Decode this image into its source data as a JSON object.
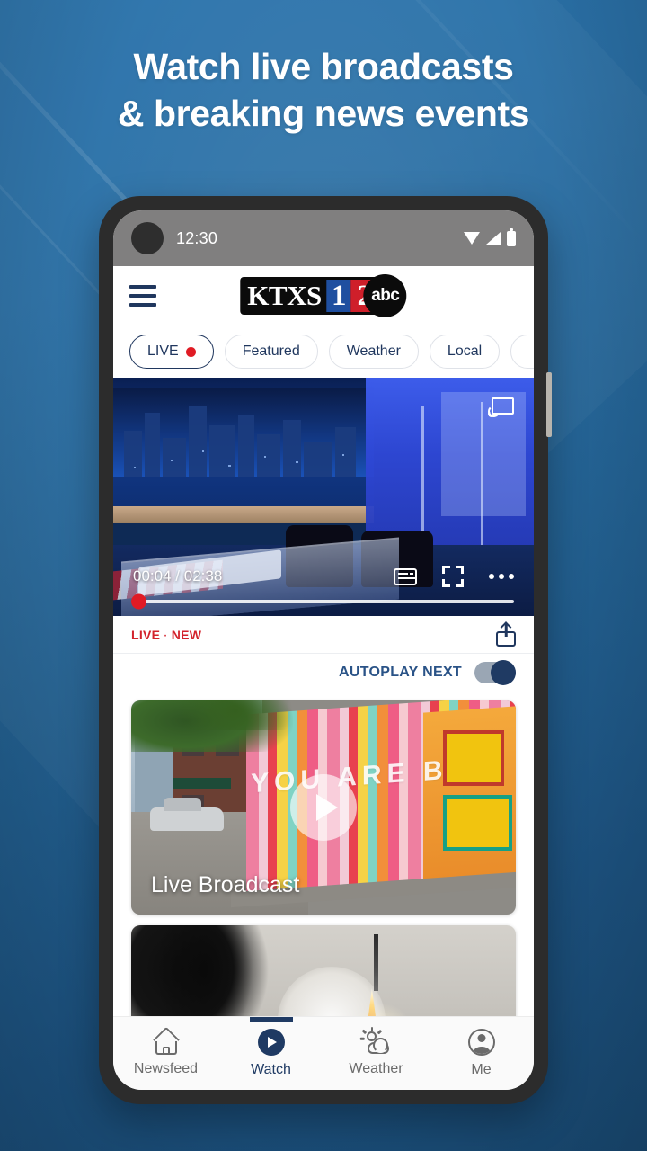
{
  "promo": {
    "headline_line1": "Watch live broadcasts",
    "headline_line2": "& breaking news events"
  },
  "statusbar": {
    "time": "12:30",
    "wifi_icon": "wifi-icon",
    "signal_icon": "signal-icon",
    "battery_icon": "battery-icon"
  },
  "appbar": {
    "menu_icon": "hamburger-menu-icon",
    "logo": {
      "call_letters": "KTXS",
      "channel_first": "1",
      "channel_second": "2",
      "network": "abc"
    }
  },
  "chips": [
    {
      "label": "LIVE",
      "has_dot": true,
      "active": true
    },
    {
      "label": "Featured",
      "has_dot": false,
      "active": false
    },
    {
      "label": "Weather",
      "has_dot": false,
      "active": false
    },
    {
      "label": "Local",
      "has_dot": false,
      "active": false
    }
  ],
  "player": {
    "cast_icon": "cast-icon",
    "current_time": "00:04",
    "separator": "/",
    "duration": "02:38",
    "cc_icon": "closed-caption-icon",
    "fullscreen_icon": "fullscreen-icon",
    "more_icon": "more-options-icon",
    "progress_percent": 2,
    "scrubber_color": "#e01b24"
  },
  "meta": {
    "live_label": "LIVE",
    "separator": "·",
    "new_label": "NEW",
    "tag_color": "#d3232c",
    "share_icon": "share-icon"
  },
  "autoplay": {
    "label": "AUTOPLAY NEXT",
    "enabled": true,
    "label_color": "#2a5387",
    "knob_color": "#1f3a63"
  },
  "feed": [
    {
      "title": "Live Broadcast",
      "mural_text": "YOU ARE BEAUTIFUL",
      "play_icon": "play-icon",
      "thumbnail": "street-mural-thumbnail"
    },
    {
      "title": "",
      "thumbnail": "rocket-launch-thumbnail"
    }
  ],
  "bottom_nav": [
    {
      "label": "Newsfeed",
      "icon": "home-icon",
      "active": false
    },
    {
      "label": "Watch",
      "icon": "play-circle-icon",
      "active": true
    },
    {
      "label": "Weather",
      "icon": "sun-cloud-icon",
      "active": false
    },
    {
      "label": "Me",
      "icon": "person-circle-icon",
      "active": false
    }
  ],
  "colors": {
    "background_blue": "#2a6fa5",
    "brand_navy": "#20375e",
    "accent_red": "#e01b24",
    "logo_blue": "#1f4fa0",
    "logo_red": "#cf1f2a"
  }
}
